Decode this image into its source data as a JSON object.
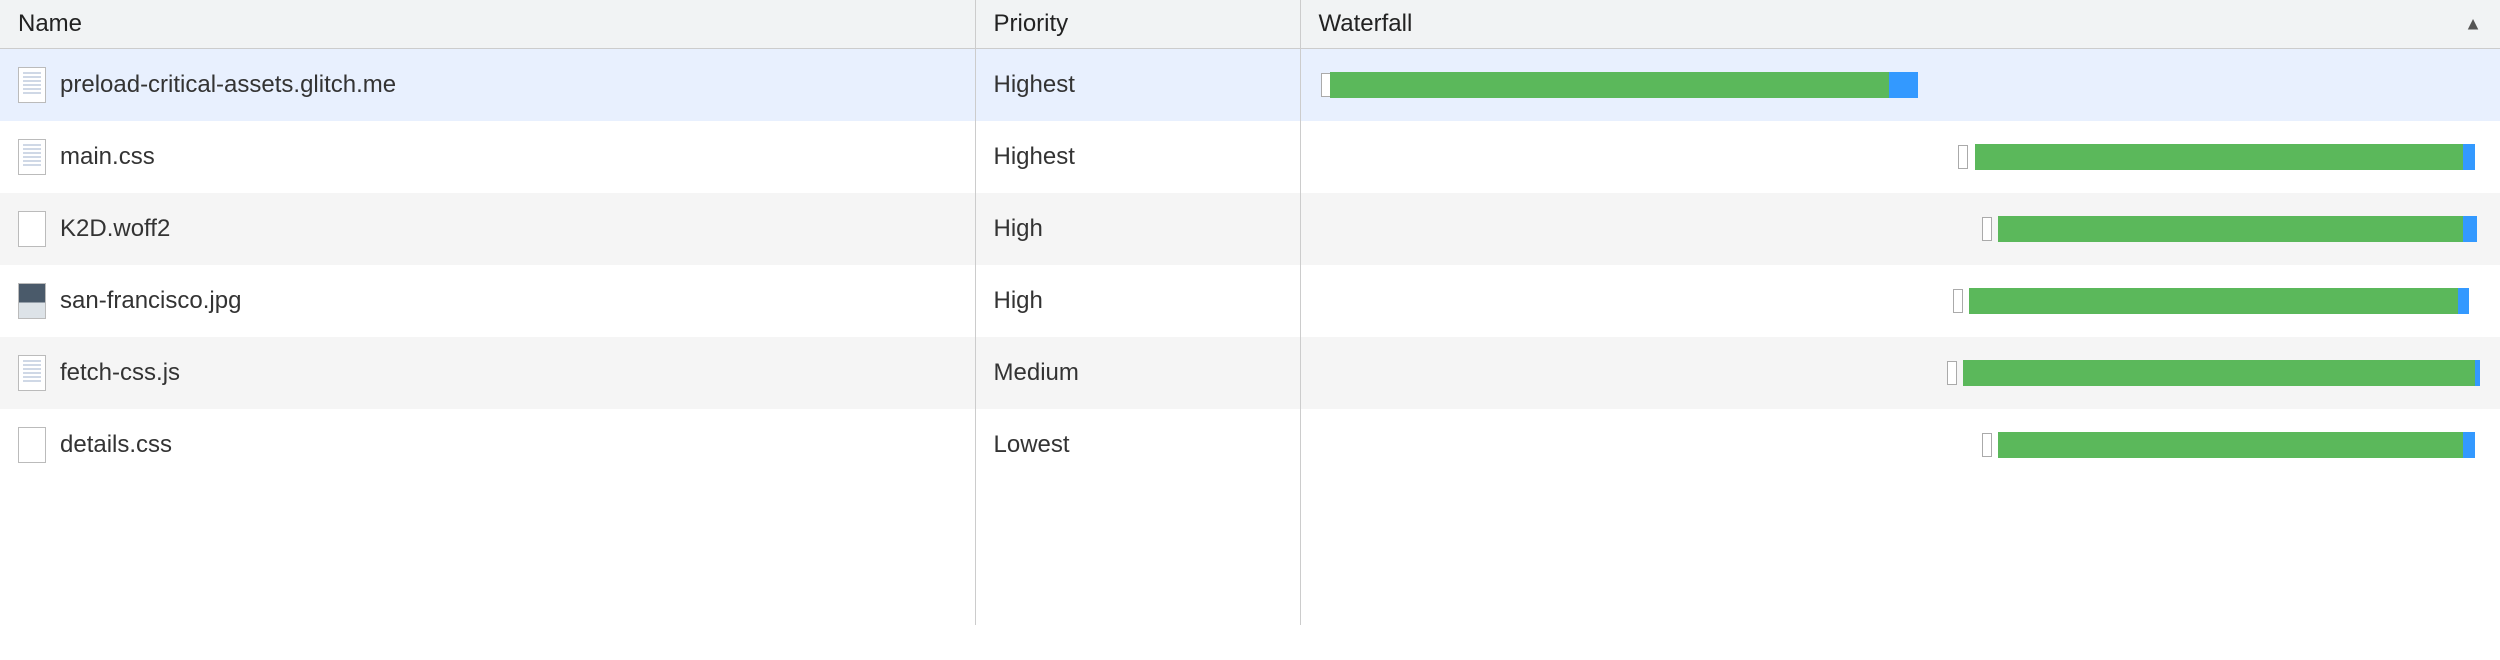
{
  "columns": {
    "name": "Name",
    "priority": "Priority",
    "waterfall": "Waterfall"
  },
  "sort": {
    "column": "waterfall",
    "direction": "asc",
    "indicator": "▲"
  },
  "rows": [
    {
      "name": "preload-critical-assets.glitch.me",
      "priority": "Highest",
      "icon": "document",
      "selected": true,
      "waterfall": {
        "queue_pct": 0.2,
        "start_pct": 1.0,
        "duration_pct": 48.0,
        "tail_pct": 2.5
      }
    },
    {
      "name": "main.css",
      "priority": "Highest",
      "icon": "document",
      "selected": false,
      "waterfall": {
        "queue_pct": 55.0,
        "start_pct": 56.4,
        "duration_pct": 42.0,
        "tail_pct": 1.0
      }
    },
    {
      "name": "K2D.woff2",
      "priority": "High",
      "icon": "blank",
      "selected": false,
      "waterfall": {
        "queue_pct": 57.0,
        "start_pct": 58.4,
        "duration_pct": 40.0,
        "tail_pct": 1.2
      }
    },
    {
      "name": "san-francisco.jpg",
      "priority": "High",
      "icon": "image",
      "selected": false,
      "waterfall": {
        "queue_pct": 54.5,
        "start_pct": 55.9,
        "duration_pct": 42.0,
        "tail_pct": 1.0
      }
    },
    {
      "name": "fetch-css.js",
      "priority": "Medium",
      "icon": "document",
      "selected": false,
      "waterfall": {
        "queue_pct": 54.0,
        "start_pct": 55.4,
        "duration_pct": 44.0,
        "tail_pct": 0.4
      }
    },
    {
      "name": "details.css",
      "priority": "Lowest",
      "icon": "blank",
      "selected": false,
      "waterfall": {
        "queue_pct": 57.0,
        "start_pct": 58.4,
        "duration_pct": 40.0,
        "tail_pct": 1.0
      }
    }
  ]
}
